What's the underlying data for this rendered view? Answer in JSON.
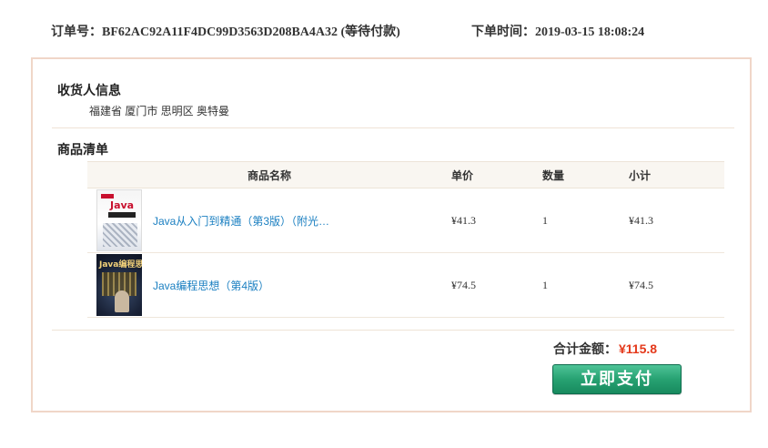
{
  "order": {
    "label": "订单号：",
    "number": "BF62AC92A11F4DC99D3563D208BA4A32",
    "status": "(等待付款)",
    "time_label": "下单时间：",
    "time": "2019-03-15 18:08:24"
  },
  "recipient": {
    "title": "收货人信息",
    "address": "福建省 厦门市 思明区 奥特曼"
  },
  "goods": {
    "title": "商品清单",
    "headers": {
      "name": "商品名称",
      "price": "单价",
      "qty": "数量",
      "subtotal": "小计"
    },
    "items": [
      {
        "name": "Java从入门到精通（第3版）（附光…",
        "price": "¥41.3",
        "qty": "1",
        "subtotal": "¥41.3",
        "thumb_text": "Java"
      },
      {
        "name": "Java编程思想（第4版）",
        "price": "¥74.5",
        "qty": "1",
        "subtotal": "¥74.5",
        "thumb_text": "Java编程思想"
      }
    ]
  },
  "summary": {
    "total_label": "合计金额：",
    "total_value": "¥115.8",
    "pay_label": "立即支付"
  },
  "colors": {
    "accent_red": "#e4391b",
    "link_blue": "#1a7fc1",
    "pay_green": "#27a272",
    "panel_border": "#f0d6c8"
  }
}
